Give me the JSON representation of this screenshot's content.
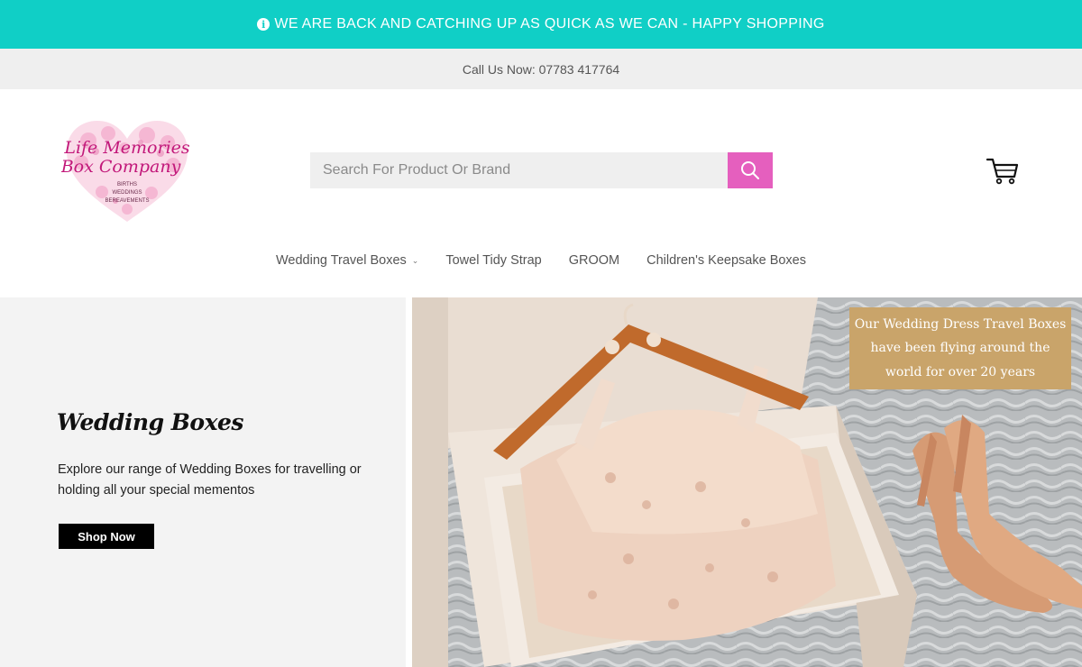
{
  "announcement": {
    "icon": "info-circle-icon",
    "text": "WE ARE BACK AND CATCHING UP AS QUICK AS WE CAN - HAPPY SHOPPING"
  },
  "contact": {
    "text": "Call Us Now: 07783 417764"
  },
  "logo": {
    "line1": "Life Memories",
    "line2": "Box Company",
    "tag1": "BIRTHS",
    "tag2": "WEDDINGS",
    "tag3": "BEREAVEMENTS"
  },
  "search": {
    "placeholder": "Search For Product Or Brand",
    "value": "",
    "icon": "search-icon"
  },
  "cart": {
    "icon": "cart-icon"
  },
  "nav": {
    "items": [
      {
        "label": "Wedding Travel Boxes",
        "has_dropdown": true
      },
      {
        "label": "Towel Tidy Strap"
      },
      {
        "label": "GROOM"
      },
      {
        "label": "Children's Keepsake Boxes"
      }
    ]
  },
  "hero": {
    "title": "Wedding Boxes",
    "text": "Explore our range of Wedding Boxes for travelling or holding all your special mementos",
    "button": "Shop Now",
    "badge": "Our Wedding Dress Travel Boxes have been flying around the world for over 20 years"
  },
  "colors": {
    "accent": "#10cfc6",
    "search_button": "#e55fbe",
    "badge": "#c9a46a",
    "hero_bg": "#f3f3f3"
  }
}
